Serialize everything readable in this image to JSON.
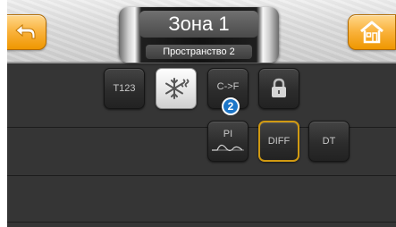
{
  "header": {
    "zone_title": "Зона 1",
    "zone_subtitle": "Пространство 2"
  },
  "buttons": {
    "t123": "T123",
    "conversion": "C->F",
    "pi": "PI",
    "diff": "DIFF",
    "dt": "DT"
  },
  "badge": "2",
  "colors": {
    "accent_orange": "#f5a623",
    "selected_border": "#d19a12",
    "badge_blue": "#1d76c8"
  },
  "icons": {
    "back": "back-arrow-icon",
    "home": "home-icon",
    "mode": "snowflake-heat-icon",
    "lock": "padlock-icon",
    "pi_curve": "wave-curve-icon"
  }
}
